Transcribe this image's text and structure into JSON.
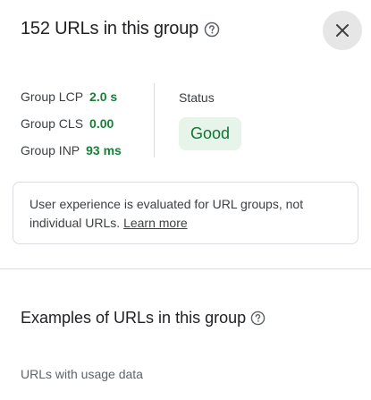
{
  "header": {
    "title": "152 URLs in this group",
    "help_icon": "help-circle-icon",
    "close_icon": "close-icon"
  },
  "metrics": [
    {
      "label": "Group LCP",
      "value": "2.0 s"
    },
    {
      "label": "Group CLS",
      "value": "0.00"
    },
    {
      "label": "Group INP",
      "value": "93 ms"
    }
  ],
  "status": {
    "label": "Status",
    "value": "Good"
  },
  "info": {
    "text": "User experience is evaluated for URL groups, not individual URLs.",
    "link_label": "Learn more"
  },
  "examples": {
    "title": "Examples of URLs in this group",
    "help_icon": "help-circle-icon",
    "subheading": "URLs with usage data"
  },
  "colors": {
    "good_text": "#188038",
    "good_chip_bg": "#e6f4ea",
    "close_bg": "#e6e6e6"
  }
}
